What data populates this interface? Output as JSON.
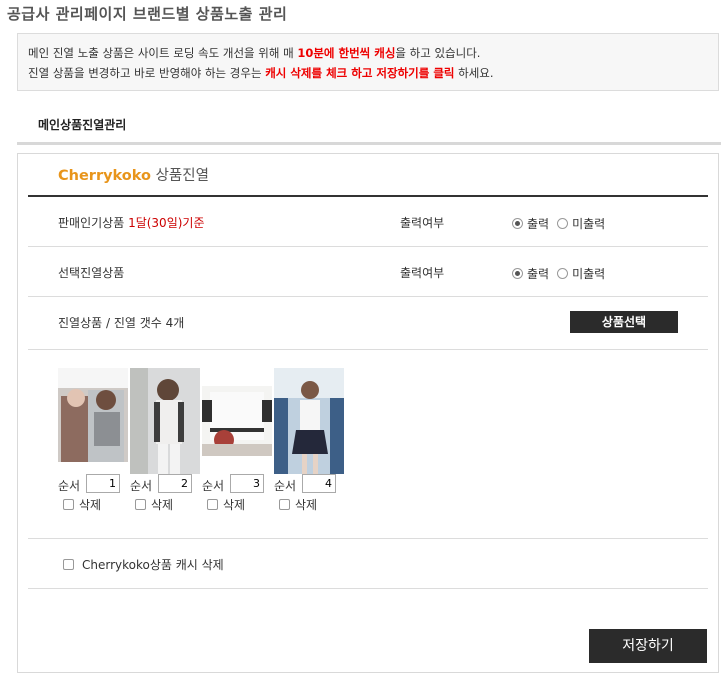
{
  "page_title": "공급사 관리페이지 브랜드별 상품노출 관리",
  "notice": {
    "line1_a": "메인 진열 노출 상품은 사이트 로딩 속도 개선을 위해 매 ",
    "line1_hl": "10분에 한번씩 캐싱",
    "line1_b": "을 하고 있습니다.",
    "line2_a": "진열 상품을 변경하고 바로 반영해야 하는 경우는 ",
    "line2_hl": "캐시 삭제를 체크 하고 저장하기를 클릭",
    "line2_b": " 하세요."
  },
  "tab": {
    "label": "메인상품진열관리"
  },
  "panel": {
    "brand": "Cherrykoko",
    "title_suffix": " 상품진열",
    "rows": [
      {
        "label": "판매인기상품 ",
        "label_red": "1달(30일)기준",
        "out_label": "출력여부",
        "opt_on": "출력",
        "opt_off": "미출력",
        "selected": "출력"
      },
      {
        "label": "선택진열상품",
        "out_label": "출력여부",
        "opt_on": "출력",
        "opt_off": "미출력",
        "selected": "출력"
      }
    ],
    "display_label": "진열상품 / 진열 갯수 4개",
    "select_button": "상품선택",
    "order_label": "순서",
    "delete_label": "삭제",
    "products": [
      {
        "order": "1"
      },
      {
        "order": "2"
      },
      {
        "order": "3"
      },
      {
        "order": "4"
      }
    ],
    "cache_delete_label": "Cherrykoko상품 캐시 삭제",
    "save_button": "저장하기"
  },
  "colors": {
    "brand": "#e8951b",
    "highlight": "#e00000",
    "button_bg": "#2b2b2b"
  }
}
